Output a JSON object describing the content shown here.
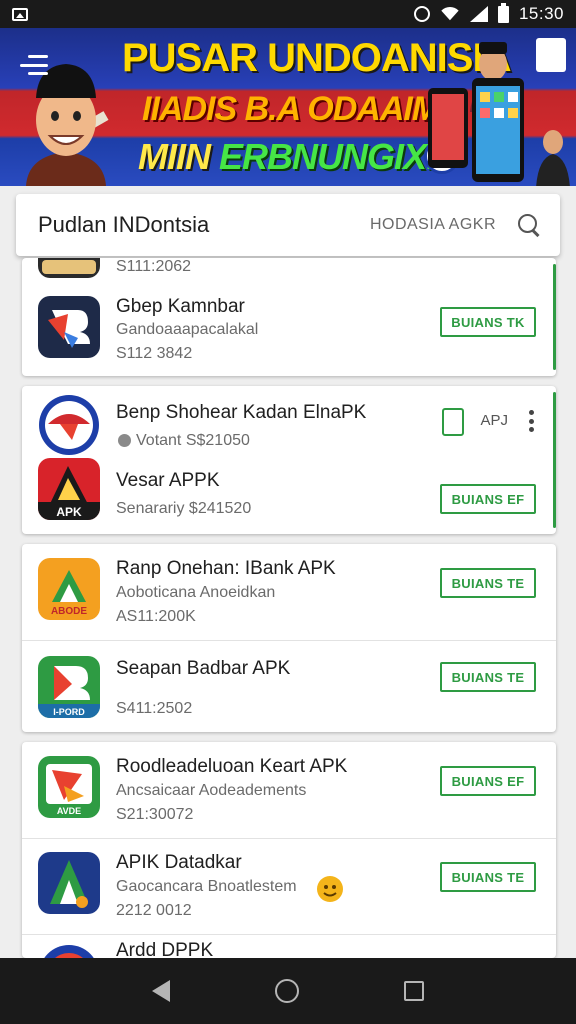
{
  "status_bar": {
    "time": "15:30"
  },
  "banner": {
    "title_line1": "PUSAR UNDOANISIA",
    "title_line2": "IIADIS B.A ODAAIMA",
    "title_line3_a": "MIIN ",
    "title_line3_b": "ERBNUNGIX!"
  },
  "search": {
    "title": "Pudlan INDontsia",
    "hint": "HODASIA AGKR"
  },
  "apps": {
    "partial_top": {
      "size": "S111:2062"
    },
    "a1": {
      "name": "Gbep Kamnbar",
      "sub": "Gandoaaapacalakal",
      "size": "S112 3842",
      "button": "BUIANS TK"
    },
    "a2": {
      "name": "Benp Shohear Kadan ElnaPK",
      "sub": "Votant S$21050",
      "badge": "APJ"
    },
    "a3": {
      "name": "Vesar APPK",
      "sub": "Senarariy $241520",
      "button": "BUIANS EF",
      "icon_text": "APK"
    },
    "a4": {
      "name": "Ranp Onehan: IBank APK",
      "sub": "Aoboticana Anoeidkan",
      "size": "AS11:200K",
      "button": "BUIANS TE",
      "icon_text": "ABODE"
    },
    "a5": {
      "name": "Seapan Badbar APK",
      "size": "S411:2502",
      "button": "BUIANS TE",
      "icon_text": "I-PORD"
    },
    "a6": {
      "name": "Roodleadeluoan Keart APK",
      "sub": "Ancsaicaar Aodeadements",
      "size": "S21:30072",
      "button": "BUIANS EF",
      "icon_text": "AVDE"
    },
    "a7": {
      "name": "APIK Datadkar",
      "sub": "Gaocancara Bnoatlestem",
      "size": "2212 0012",
      "button": "BUIANS TE"
    },
    "a8": {
      "name": "Ardd DPPK"
    }
  },
  "colors": {
    "accent_green": "#2e9b43",
    "banner_red": "#d12a2e",
    "banner_blue": "#1d3ea8"
  }
}
